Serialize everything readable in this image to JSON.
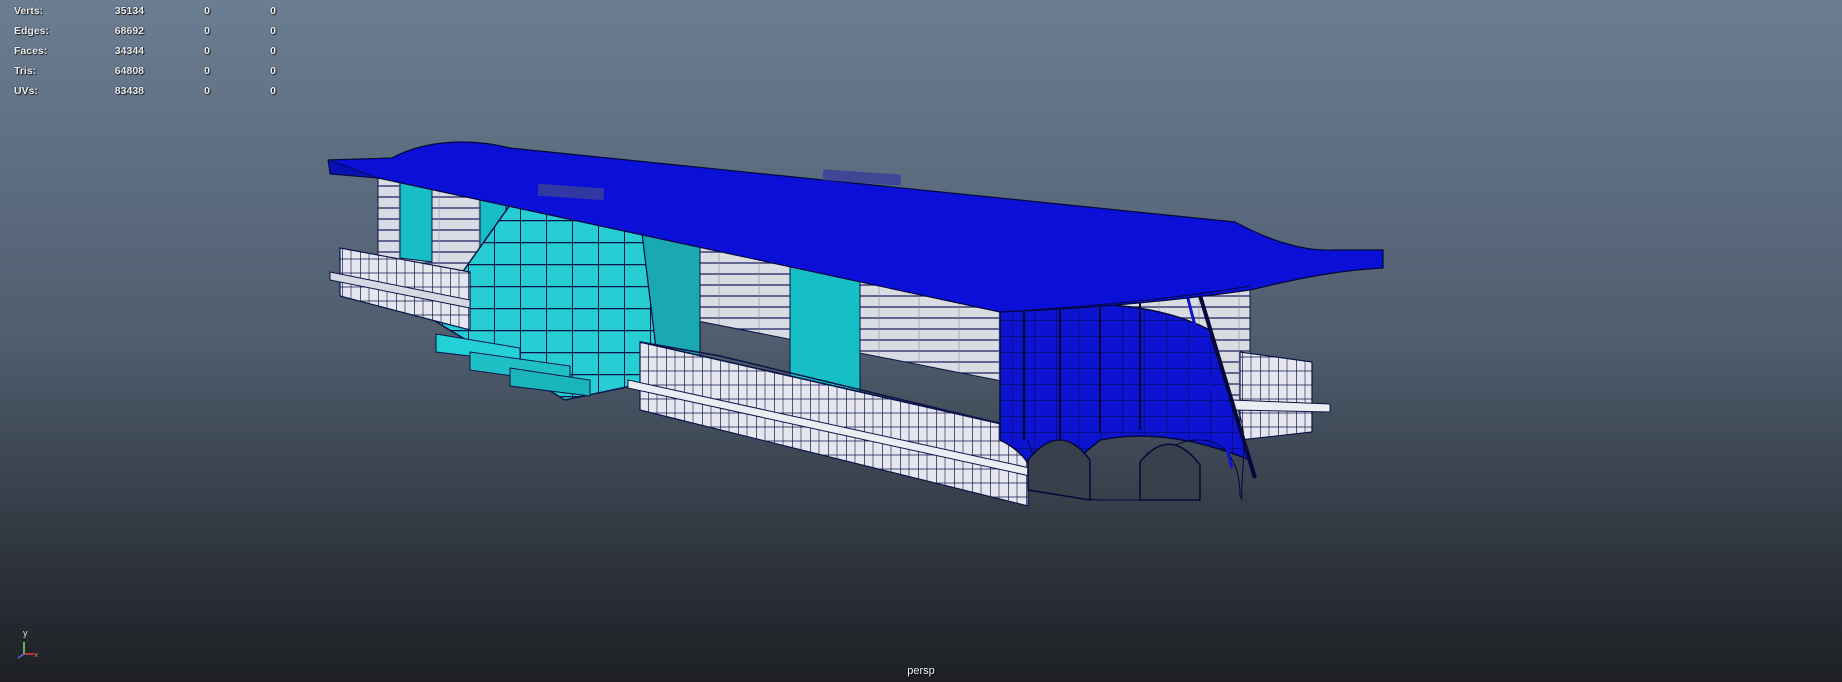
{
  "hud": {
    "rows": [
      {
        "label": "Verts:",
        "v1": "35134",
        "v2": "0",
        "v3": "0"
      },
      {
        "label": "Edges:",
        "v1": "68692",
        "v2": "0",
        "v3": "0"
      },
      {
        "label": "Faces:",
        "v1": "34344",
        "v2": "0",
        "v3": "0"
      },
      {
        "label": "Tris:",
        "v1": "64808",
        "v2": "0",
        "v3": "0"
      },
      {
        "label": "UVs:",
        "v1": "83438",
        "v2": "0",
        "v3": "0"
      }
    ]
  },
  "viewport": {
    "camera": "persp",
    "axis_y": "y"
  },
  "colors": {
    "roof_blue": "#0a10d8",
    "glass_cyan": "#1ec8cf",
    "wall_gray": "#d9dbe2",
    "wire": "#0c1448"
  }
}
